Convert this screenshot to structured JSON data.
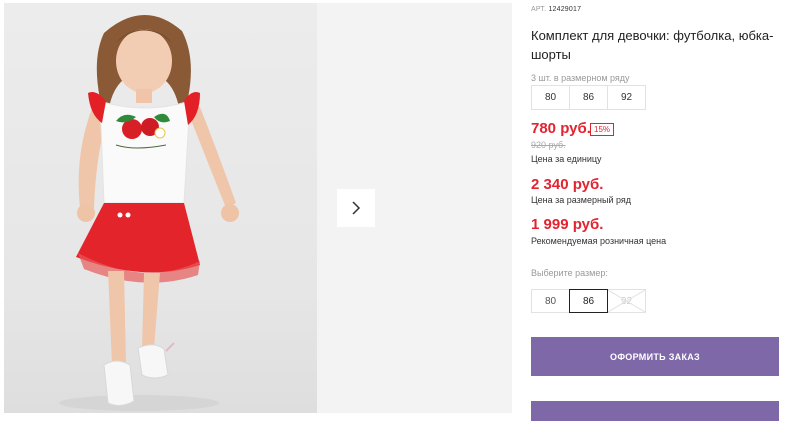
{
  "product": {
    "art_label": "АРТ.",
    "art_number": "12429017",
    "title": "Комплект для девочки: футболка, юбка-шорты"
  },
  "pack": {
    "label": "3 шт. в размерном ряду",
    "sizes": [
      "80",
      "86",
      "92"
    ]
  },
  "prices": {
    "unit_price": "780 руб.",
    "discount": "15%",
    "old_price": "920 руб.",
    "unit_label": "Цена за единицу",
    "set_price": "2 340 руб.",
    "set_label": "Цена за размерный ряд",
    "rrp_price": "1 999 руб.",
    "rrp_label": "Рекомендуемая розничная цена",
    "price_color": "#e3232f"
  },
  "size_selector": {
    "label": "Выберите размер:",
    "options": [
      "80",
      "86",
      "92"
    ],
    "selected": "86",
    "disabled": "92"
  },
  "actions": {
    "order_label": "ОФОРМИТЬ ЗАКАЗ",
    "button_color": "#7e68a8"
  },
  "gallery": {
    "next_icon": "chevron-right-icon"
  }
}
